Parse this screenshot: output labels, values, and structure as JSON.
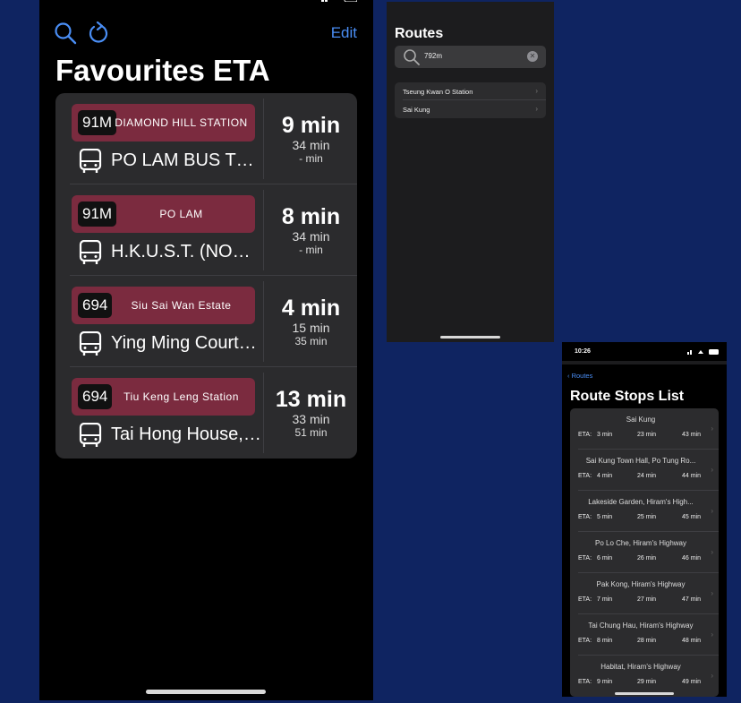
{
  "favourites": {
    "edit_label": "Edit",
    "title": "Favourites ETA",
    "items": [
      {
        "route": "91M",
        "destination": "DIAMOND HILL STATION",
        "stop": "PO LAM BUS TER...",
        "eta_main": "9 min",
        "eta_2": "34 min",
        "eta_3": "- min"
      },
      {
        "route": "91M",
        "destination": "PO LAM",
        "stop": "H.K.U.S.T. (NORTH)",
        "eta_main": "8 min",
        "eta_2": "34 min",
        "eta_3": "- min"
      },
      {
        "route": "694",
        "destination": "Siu Sai Wan Estate",
        "stop": "Ying Ming Court, P...",
        "eta_main": "4 min",
        "eta_2": "15 min",
        "eta_3": "35 min"
      },
      {
        "route": "694",
        "destination": "Tiu Keng Leng Station",
        "stop": "Tai Hong House, Ta...",
        "eta_main": "13 min",
        "eta_2": "33 min",
        "eta_3": "51 min"
      }
    ]
  },
  "routes": {
    "title": "Routes",
    "search_value": "792m",
    "items": [
      {
        "label": "Tseung Kwan O Station"
      },
      {
        "label": "Sai Kung"
      }
    ]
  },
  "route_stops": {
    "status_time": "10:26",
    "back_label": "Routes",
    "title": "Route Stops List",
    "eta_label": "ETA:",
    "stops": [
      {
        "name": "Sai Kung",
        "eta": [
          "3 min",
          "23 min",
          "43 min"
        ]
      },
      {
        "name": "Sai Kung Town Hall, Po Tung Ro...",
        "eta": [
          "4 min",
          "24 min",
          "44 min"
        ]
      },
      {
        "name": "Lakeside Garden, Hiram's High...",
        "eta": [
          "5 min",
          "25 min",
          "45 min"
        ]
      },
      {
        "name": "Po Lo Che, Hiram's Highway",
        "eta": [
          "6 min",
          "26 min",
          "46 min"
        ]
      },
      {
        "name": "Pak Kong, Hiram's Highway",
        "eta": [
          "7 min",
          "27 min",
          "47 min"
        ]
      },
      {
        "name": "Tai Chung Hau, Hiram's Highway",
        "eta": [
          "8 min",
          "28 min",
          "48 min"
        ]
      },
      {
        "name": "Habitat, Hiram's Highway",
        "eta": [
          "9 min",
          "29 min",
          "49 min"
        ]
      }
    ]
  },
  "colors": {
    "background": "#0f2461",
    "accent": "#4a8ef5",
    "banner": "#7b2b3f"
  }
}
